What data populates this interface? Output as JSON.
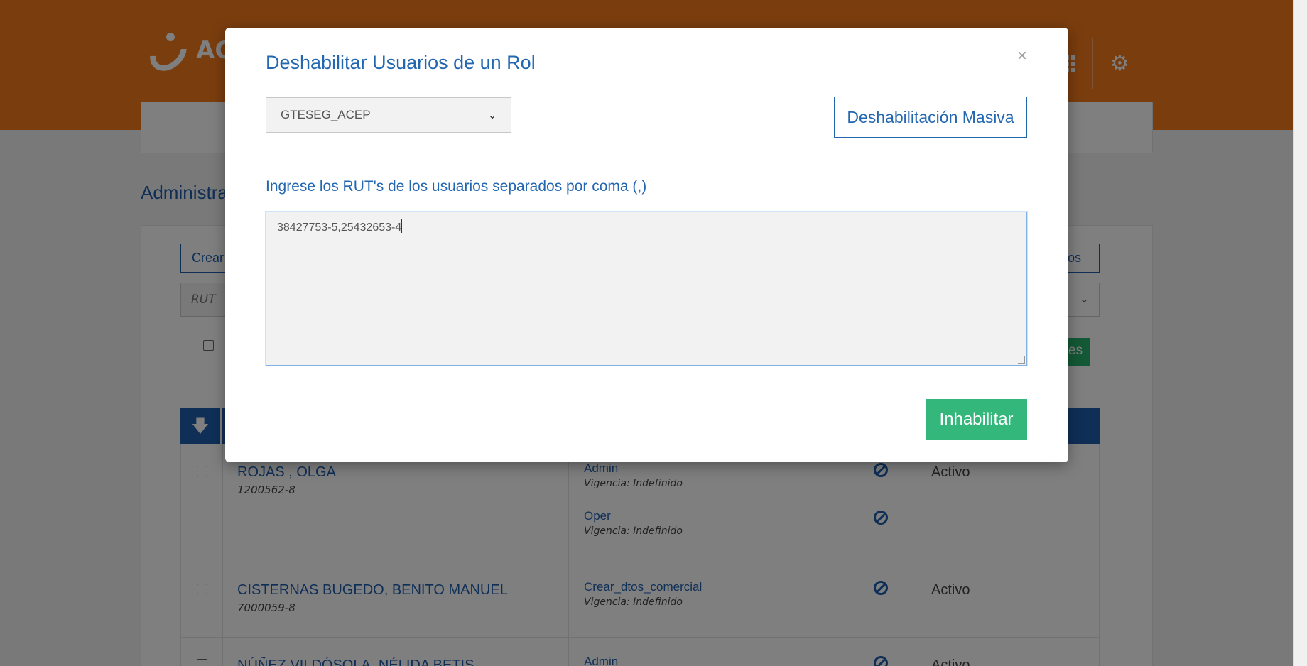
{
  "header": {
    "logo_text": "AC",
    "icons": [
      "grid-icon",
      "gear-icon"
    ]
  },
  "page": {
    "title": "Administra",
    "crear_label": "Crear",
    "right_btn_label": "dos",
    "rut_placeholder": "RUT",
    "green_btn_label": "es"
  },
  "table": {
    "sort_icon": "arrow-down-icon",
    "rows": [
      {
        "name": "ROJAS , OLGA",
        "rut": "1200562-8",
        "roles": [
          {
            "role": "Admin",
            "vigencia": "Vigencia: Indefinido"
          },
          {
            "role": "Oper",
            "vigencia": "Vigencia: Indefinido"
          }
        ],
        "status": "Activo"
      },
      {
        "name": "CISTERNAS BUGEDO, BENITO MANUEL",
        "rut": "7000059-8",
        "roles": [
          {
            "role": "Crear_dtos_comercial",
            "vigencia": "Vigencia: Indefinido"
          }
        ],
        "status": "Activo"
      },
      {
        "name": "NÚÑEZ VILDÓSOLA, NÉLIDA BETIS",
        "rut": "",
        "roles": [
          {
            "role": "Admin",
            "vigencia": ""
          }
        ],
        "status": "Activo"
      }
    ]
  },
  "modal": {
    "title": "Deshabilitar Usuarios de un Rol",
    "close_label": "×",
    "role_select": {
      "selected": "GTESEG_ACEP"
    },
    "masiva_button": "Deshabilitación Masiva",
    "ruts_label": "Ingrese los RUT's de los usuarios separados por coma (,)",
    "ruts_value": "38427753-5,25432653-4",
    "submit_button": "Inhabilitar"
  },
  "colors": {
    "brand_orange": "#f47b1c",
    "primary_blue": "#2467b1",
    "success_green": "#34b77a"
  }
}
